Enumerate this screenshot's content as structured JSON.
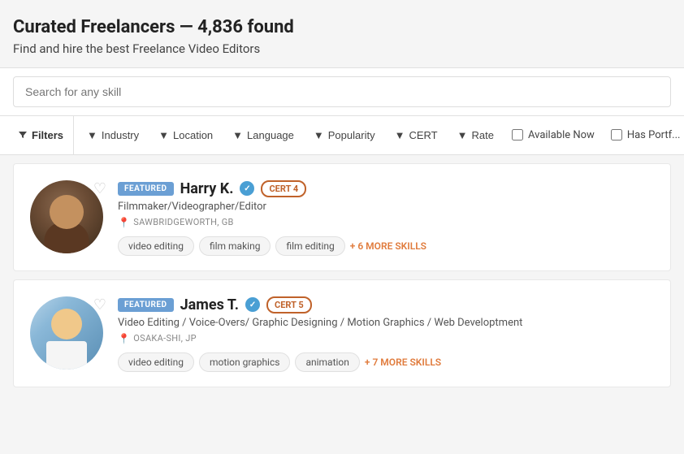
{
  "header": {
    "title": "Curated Freelancers — 4,836 found",
    "subtitle": "Find and hire the best Freelance Video Editors"
  },
  "search": {
    "placeholder": "Search for any skill"
  },
  "filters": {
    "main_label": "Filters",
    "items": [
      {
        "id": "industry",
        "label": "Industry",
        "has_arrow": true
      },
      {
        "id": "location",
        "label": "Location",
        "has_arrow": true
      },
      {
        "id": "language",
        "label": "Language",
        "has_arrow": true
      },
      {
        "id": "popularity",
        "label": "Popularity",
        "has_arrow": true
      },
      {
        "id": "cert",
        "label": "CERT",
        "has_arrow": true
      },
      {
        "id": "rate",
        "label": "Rate",
        "has_arrow": true
      }
    ],
    "checkboxes": [
      {
        "id": "available-now",
        "label": "Available Now"
      },
      {
        "id": "has-portfolio",
        "label": "Has Portf..."
      }
    ]
  },
  "freelancers": [
    {
      "id": "harry",
      "featured": true,
      "featured_label": "FEATURED",
      "name": "Harry K.",
      "verified": true,
      "cert": "CERT 4",
      "cert_class": "cert4",
      "title": "Filmmaker/Videographer/Editor",
      "location": "SAWBRIDGEWORTH, GB",
      "skills": [
        "video editing",
        "film making",
        "film editing"
      ],
      "more_skills": "+ 6 MORE SKILLS"
    },
    {
      "id": "james",
      "featured": true,
      "featured_label": "FEATURED",
      "name": "James T.",
      "verified": true,
      "cert": "CERT 5",
      "cert_class": "cert5",
      "title": "Video Editing / Voice-Overs/ Graphic Designing / Motion Graphics / Web Developtment",
      "location": "OSAKA-SHI, JP",
      "skills": [
        "video editing",
        "motion graphics",
        "animation"
      ],
      "more_skills": "+ 7 MORE SKILLS"
    }
  ],
  "colors": {
    "featured_bg": "#6b9fd4",
    "cert_color": "#c0622a",
    "more_skills_color": "#e07b3c",
    "verified_bg": "#4a9fd4"
  }
}
